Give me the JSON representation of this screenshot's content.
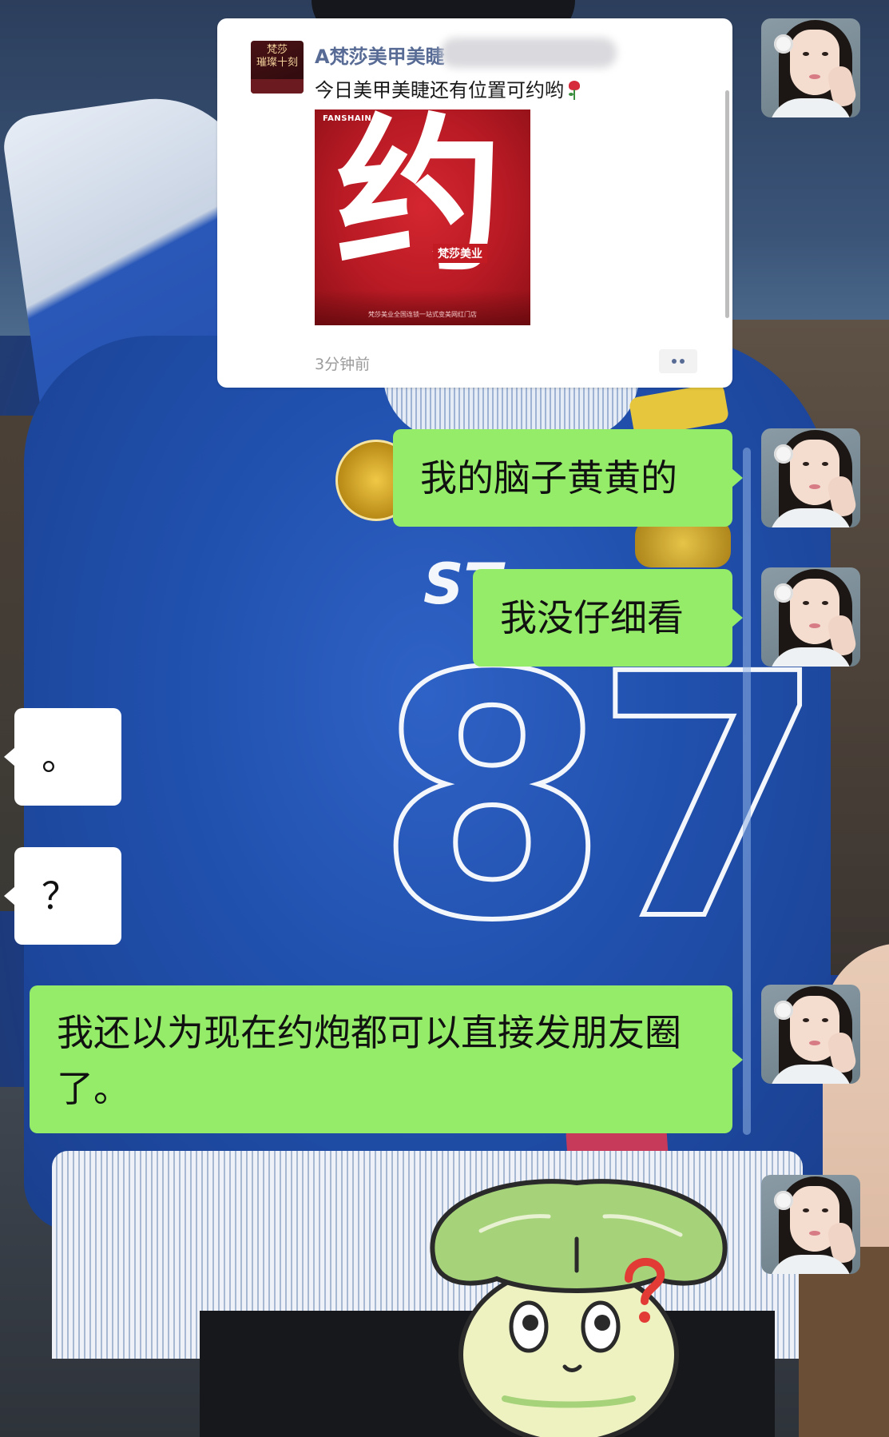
{
  "moment": {
    "sender": "A梵莎美甲美睫",
    "text": "今日美甲美睫还有位置可约哟",
    "image": {
      "brand": "FANSHAIN",
      "main_char": "约",
      "tag": "梵莎美业",
      "footer": "梵莎美业全国连锁一站式变美网红门店"
    },
    "card_avatar_text": "梵莎\n璀璨十刻",
    "time": "3分钟前"
  },
  "messages": [
    {
      "side": "right",
      "text": "我的脑子黄黄的"
    },
    {
      "side": "right",
      "text": "我没仔细看"
    },
    {
      "side": "left",
      "text": "。"
    },
    {
      "side": "left",
      "text": "？"
    },
    {
      "side": "right",
      "text": "我还以为现在约炮都可以直接发朋友圈了。"
    }
  ],
  "background": {
    "jersey_number": "87",
    "jersey_text": "ST"
  },
  "colors": {
    "self_bubble": "#95ec69",
    "other_bubble": "#ffffff",
    "link_name": "#576b95"
  }
}
